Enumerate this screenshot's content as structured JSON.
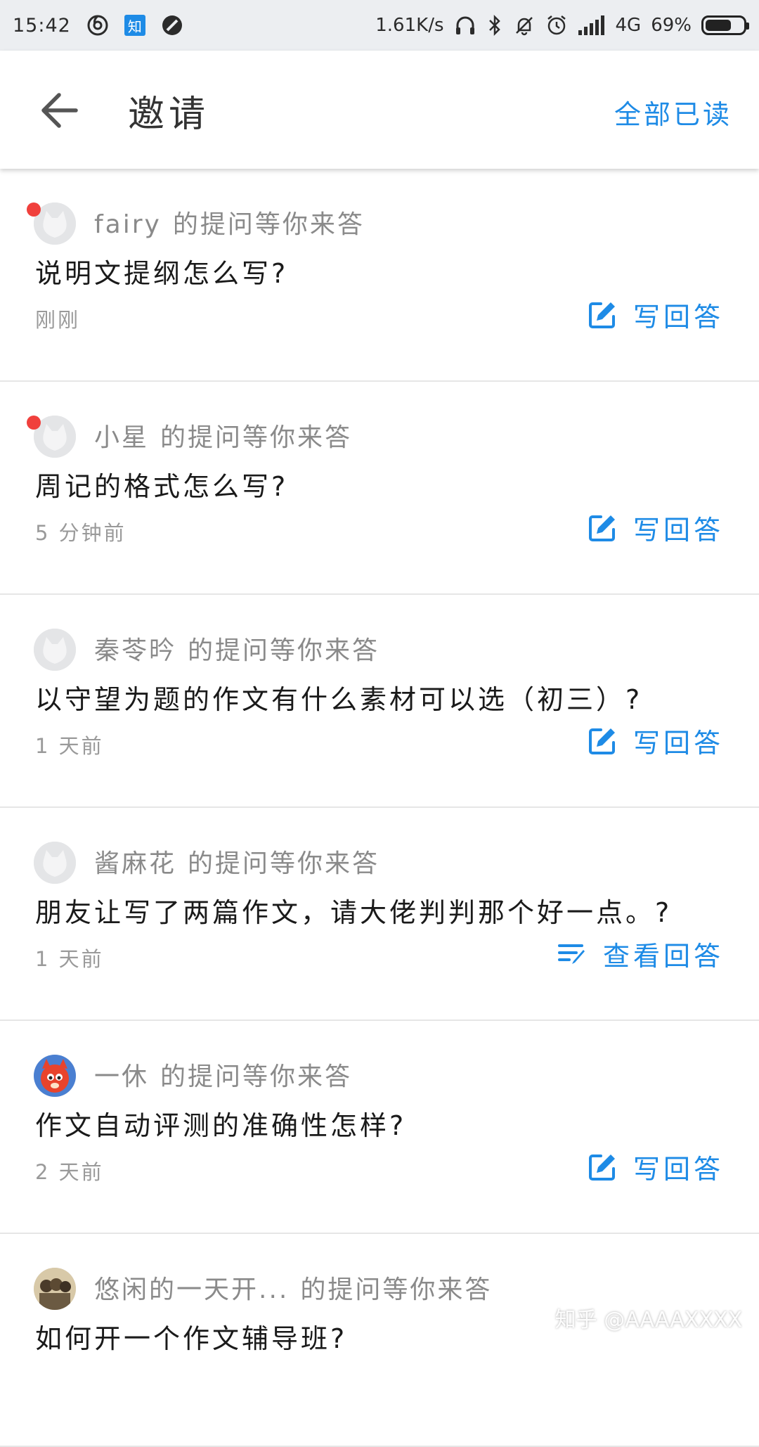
{
  "status_bar": {
    "time": "15:42",
    "zhihu_badge": "知",
    "net_speed": "1.61K/s",
    "network": "4G",
    "battery": "69%",
    "battery_level": 0.69,
    "icons": [
      "netease-music-icon",
      "zhihu-icon",
      "dnd-icon",
      "headphones-icon",
      "bluetooth-icon",
      "bell-off-icon",
      "alarm-icon",
      "signal-icon",
      "battery-icon"
    ]
  },
  "header": {
    "title": "邀请",
    "mark_all_read": "全部已读"
  },
  "invite_suffix": "的提问等你来答",
  "items": [
    {
      "user": "fairy",
      "question": "说明文提纲怎么写?",
      "time": "刚刚",
      "action": "写回答",
      "unread": true,
      "avatar": "default"
    },
    {
      "user": "小星",
      "question": "周记的格式怎么写?",
      "time": "5 分钟前",
      "action": "写回答",
      "unread": true,
      "avatar": "default"
    },
    {
      "user": "秦苓昑",
      "question": "以守望为题的作文有什么素材可以选（初三）?",
      "time": "1 天前",
      "action": "写回答",
      "unread": false,
      "avatar": "default"
    },
    {
      "user": "酱麻花",
      "question": "朋友让写了两篇作文，请大佬判判那个好一点。?",
      "time": "1 天前",
      "action": "查看回答",
      "unread": false,
      "avatar": "default"
    },
    {
      "user": "一休",
      "question": "作文自动评测的准确性怎样?",
      "time": "2 天前",
      "action": "写回答",
      "unread": false,
      "avatar": "fox"
    },
    {
      "user": "悠闲的一天开...",
      "question": "如何开一个作文辅导班?",
      "time": "",
      "action": "",
      "unread": false,
      "avatar": "photo"
    }
  ],
  "watermark": "知乎 @AAAAXXXX",
  "colors": {
    "accent": "#1e8be6",
    "unread": "#f0403c",
    "secondary_text": "#8a8a8a"
  }
}
